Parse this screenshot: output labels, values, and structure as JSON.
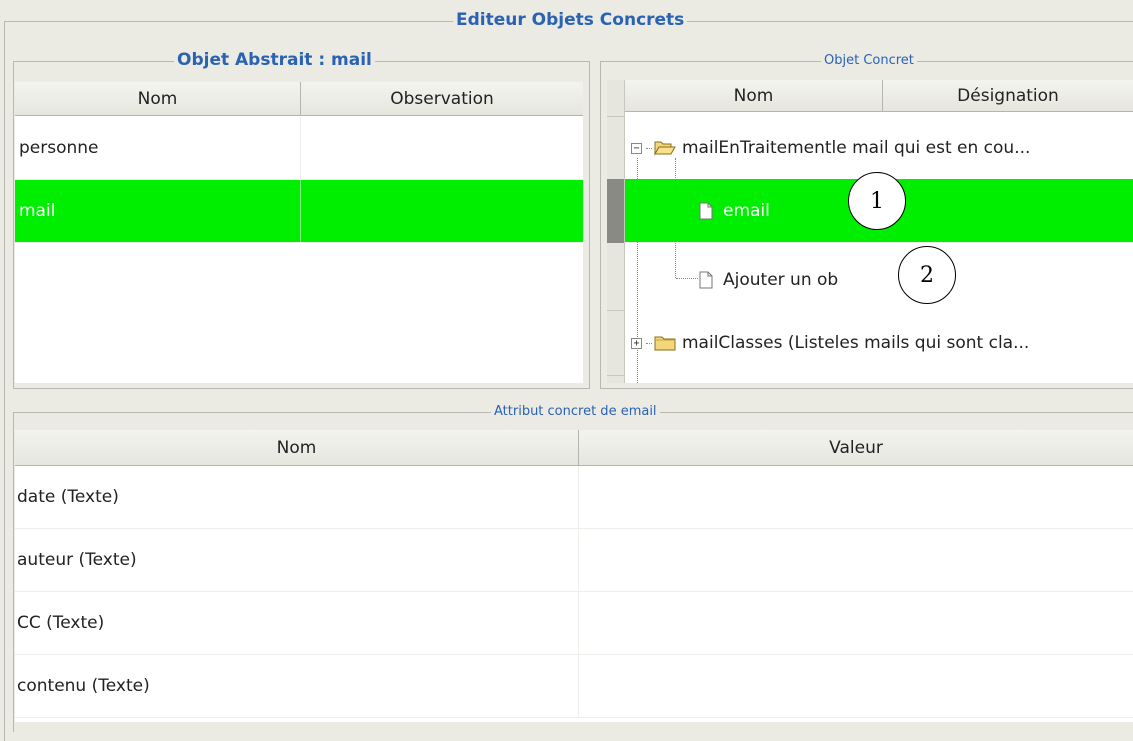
{
  "window_title": "Editeur Objets Concrets",
  "abstract_panel": {
    "title": "Objet Abstrait : mail",
    "columns": [
      "Nom",
      "Observation"
    ],
    "rows": [
      {
        "nom": "personne",
        "observation": ""
      },
      {
        "nom": "mail",
        "observation": ""
      }
    ],
    "selected_index": 1
  },
  "concrete_panel": {
    "title": "Objet Concret",
    "columns": [
      "Nom",
      "Désignation"
    ],
    "tree": {
      "node1_label": "mailEnTraitementle mail qui est en cou...",
      "node1_expander": "−",
      "child_selected": "email",
      "child_add": "Ajouter un ob",
      "node2_label": "mailClasses (Listeles mails qui sont cla...",
      "node2_expander": "+"
    },
    "callouts": [
      "1",
      "2"
    ]
  },
  "attributes_panel": {
    "title": "Attribut concret de email",
    "columns": [
      "Nom",
      "Valeur"
    ],
    "rows": [
      {
        "nom": "date (Texte)",
        "valeur": ""
      },
      {
        "nom": "auteur (Texte)",
        "valeur": ""
      },
      {
        "nom": "CC (Texte)",
        "valeur": ""
      },
      {
        "nom": "contenu (Texte)",
        "valeur": ""
      }
    ]
  },
  "colors": {
    "selection": "#00ee00",
    "title_blue": "#2a62b4",
    "background": "#ebebe4"
  },
  "icons": [
    "expander-minus-icon",
    "folder-open-icon",
    "document-icon",
    "expander-plus-icon",
    "folder-icon"
  ]
}
